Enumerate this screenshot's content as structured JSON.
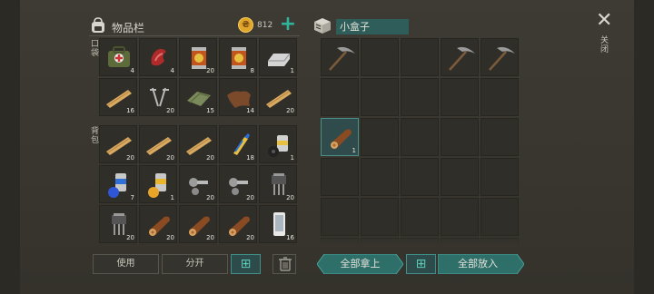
{
  "inventory": {
    "title": "物品栏",
    "coins": "812",
    "pocket_label": "口袋",
    "backpack_label": "背包",
    "pocket_slots": [
      {
        "item": "first-aid-bag",
        "count": "4"
      },
      {
        "item": "meat",
        "count": "4"
      },
      {
        "item": "canned-food",
        "count": "20"
      },
      {
        "item": "canned-food",
        "count": "8"
      },
      {
        "item": "metal-ingot",
        "count": "1"
      },
      {
        "item": "wood-plank",
        "count": "16"
      },
      {
        "item": "nails",
        "count": "20"
      },
      {
        "item": "cloth",
        "count": "15"
      },
      {
        "item": "leather",
        "count": "14"
      },
      {
        "item": "wood-plank",
        "count": "20"
      }
    ],
    "backpack_slots": [
      {
        "item": "wood-plank",
        "count": "20"
      },
      {
        "item": "wood-plank",
        "count": "20"
      },
      {
        "item": "wood-plank",
        "count": "20"
      },
      {
        "item": "glue",
        "count": "18"
      },
      {
        "item": "spray-can-tape",
        "count": "1"
      },
      {
        "item": "spray-can-blue",
        "count": "7"
      },
      {
        "item": "spray-can-yellow",
        "count": "1"
      },
      {
        "item": "bolts",
        "count": "20"
      },
      {
        "item": "bolts",
        "count": "20"
      },
      {
        "item": "transistor",
        "count": "20"
      },
      {
        "item": "transistor",
        "count": "20"
      },
      {
        "item": "log",
        "count": "20"
      },
      {
        "item": "log",
        "count": "20"
      },
      {
        "item": "log",
        "count": "20"
      },
      {
        "item": "smartphone",
        "count": "16"
      }
    ],
    "use_label": "使用",
    "split_label": "分开"
  },
  "container": {
    "title": "小盒子",
    "close_label": "关闭",
    "take_all_label": "全部拿上",
    "put_all_label": "全部放入",
    "slots": [
      {
        "item": "pickaxe",
        "count": "",
        "durability": "",
        "selected": false
      },
      {
        "item": "",
        "count": ""
      },
      {
        "item": "",
        "count": ""
      },
      {
        "item": "pickaxe",
        "count": "",
        "selected": false
      },
      {
        "item": "pickaxe",
        "count": ""
      },
      {
        "item": "",
        "count": ""
      },
      {
        "item": "",
        "count": ""
      },
      {
        "item": "",
        "count": ""
      },
      {
        "item": "",
        "count": ""
      },
      {
        "item": "",
        "count": ""
      },
      {
        "item": "log",
        "count": "1",
        "selected": true
      },
      {
        "item": "",
        "count": ""
      },
      {
        "item": "",
        "count": ""
      },
      {
        "item": "",
        "count": ""
      },
      {
        "item": "",
        "count": ""
      },
      {
        "item": "",
        "count": ""
      },
      {
        "item": "",
        "count": ""
      },
      {
        "item": "",
        "count": ""
      },
      {
        "item": "",
        "count": ""
      },
      {
        "item": "",
        "count": ""
      },
      {
        "item": "",
        "count": ""
      },
      {
        "item": "",
        "count": ""
      },
      {
        "item": "",
        "count": ""
      },
      {
        "item": "",
        "count": ""
      },
      {
        "item": "",
        "count": ""
      },
      {
        "item": "",
        "count": ""
      },
      {
        "item": "",
        "count": ""
      },
      {
        "item": "",
        "count": ""
      },
      {
        "item": "",
        "count": ""
      },
      {
        "item": "",
        "count": ""
      }
    ]
  },
  "icons": {
    "bag": "backpack-icon",
    "box": "box-icon",
    "coin": "coin-icon",
    "sort": "grid-sort-icon",
    "trash": "trash-icon",
    "close": "close-icon"
  },
  "colors": {
    "accent": "#2fb39a",
    "button_teal": "#2e6f6a",
    "selected_slot": "#2f4b4b",
    "coin": "#e0a52a"
  }
}
